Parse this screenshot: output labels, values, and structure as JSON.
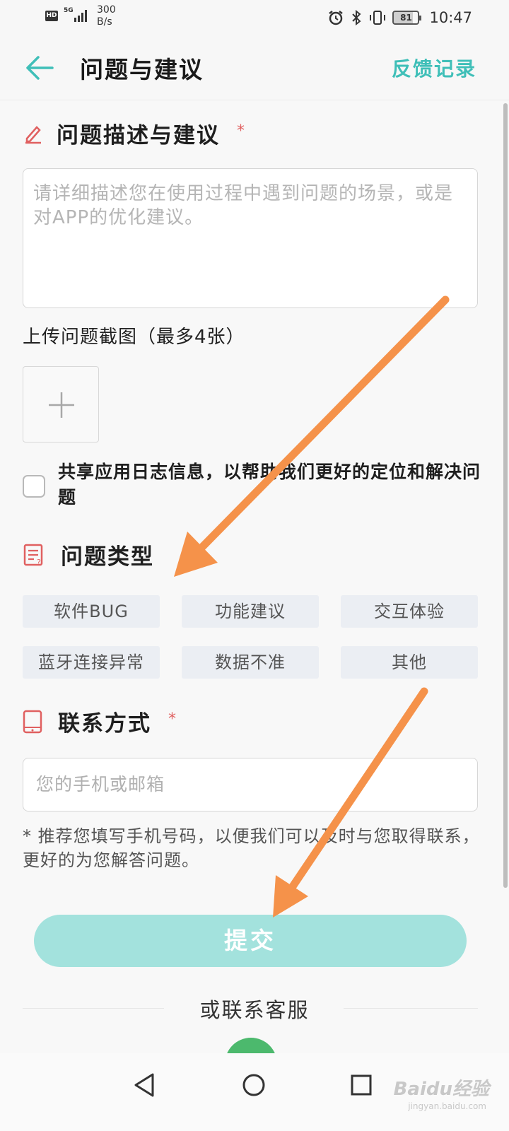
{
  "status_bar": {
    "hd": "HD",
    "network": "5G",
    "speed_value": "300",
    "speed_unit": "B/s",
    "battery": "81",
    "time": "10:47"
  },
  "header": {
    "title": "问题与建议",
    "feedback_link": "反馈记录"
  },
  "description": {
    "title": "问题描述与建议",
    "required": "*",
    "placeholder": "请详细描述您在使用过程中遇到问题的场景，或是对APP的优化建议。",
    "upload_label": "上传问题截图（最多4张）",
    "share_log_text": "共享应用日志信息，以帮助我们更好的定位和解决问题",
    "share_log_checked": false
  },
  "problem_type": {
    "title": "问题类型",
    "options": [
      "软件BUG",
      "功能建议",
      "交互体验",
      "蓝牙连接异常",
      "数据不准",
      "其他"
    ]
  },
  "contact": {
    "title": "联系方式",
    "required": "*",
    "placeholder": "您的手机或邮箱",
    "hint": "* 推荐您填写手机号码，以便我们可以及时与您取得联系，更好的为您解答问题。"
  },
  "submit_label": "提交",
  "service_label": "或联系客服",
  "colors": {
    "accent": "#3fbfb8",
    "submit_disabled": "#a3e2dd",
    "icon_red": "#e06060",
    "arrow": "#f5924a"
  },
  "watermark": {
    "brand": "Baidu经验",
    "url": "jingyan.baidu.com"
  }
}
